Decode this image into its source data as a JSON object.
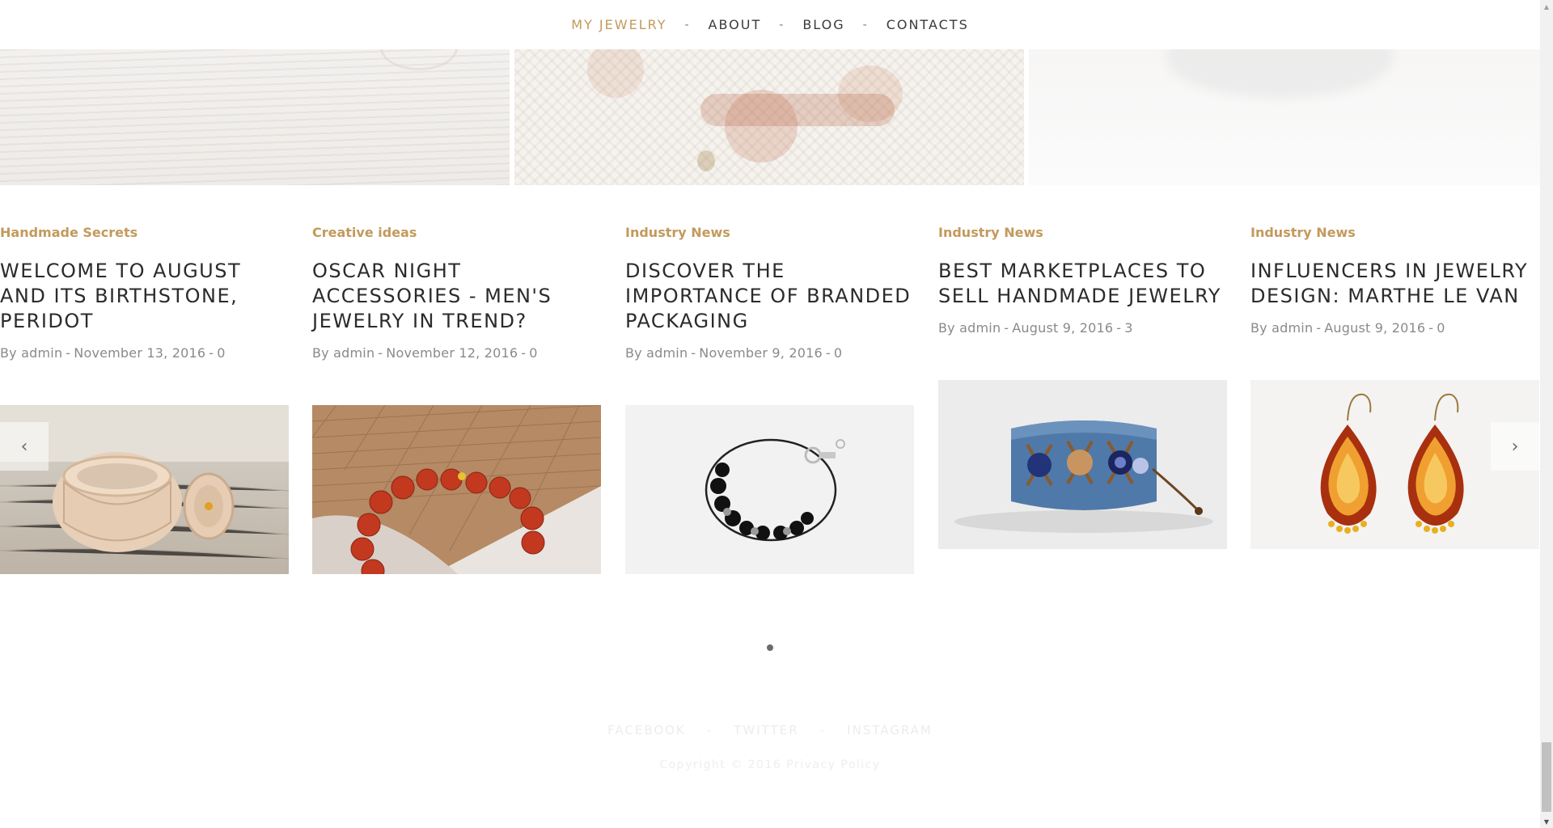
{
  "nav": {
    "items": [
      {
        "label": "MY JEWELRY",
        "active": true
      },
      {
        "label": "ABOUT",
        "active": false
      },
      {
        "label": "BLOG",
        "active": false
      },
      {
        "label": "CONTACTS",
        "active": false
      }
    ],
    "separator": "-"
  },
  "posts": [
    {
      "category": "Handmade Secrets",
      "title": "WELCOME TO AUGUST AND ITS BIRTHSTONE, PERIDOT",
      "author_prefix": "By",
      "author": "admin",
      "date": "November 13, 2016",
      "comments": "0",
      "image_icon": "bracelet-ring-photo-icon"
    },
    {
      "category": "Creative ideas",
      "title": "OSCAR NIGHT ACCESSORIES - MEN'S JEWELRY IN TREND?",
      "author_prefix": "By",
      "author": "admin",
      "date": "November 12, 2016",
      "comments": "0",
      "image_icon": "red-bead-bracelet-photo-icon"
    },
    {
      "category": "Industry News",
      "title": "DISCOVER THE IMPORTANCE OF BRANDED PACKAGING",
      "author_prefix": "By",
      "author": "admin",
      "date": "November 9, 2016",
      "comments": "0",
      "image_icon": "black-bead-bracelet-photo-icon"
    },
    {
      "category": "Industry News",
      "title": "BEST MARKETPLACES TO SELL HANDMADE JEWELRY",
      "author_prefix": "By",
      "author": "admin",
      "date": "August 9, 2016",
      "comments": "3",
      "image_icon": "blue-leather-cuff-photo-icon"
    },
    {
      "category": "Industry News",
      "title": "INFLUENCERS IN JEWELRY DESIGN: MARTHE LE VAN",
      "author_prefix": "By",
      "author": "admin",
      "date": "August 9, 2016",
      "comments": "0",
      "image_icon": "amber-earrings-photo-icon"
    }
  ],
  "carousel": {
    "prev_icon": "chevron-left-icon",
    "next_icon": "chevron-right-icon",
    "prev_glyph": "‹",
    "next_glyph": "›",
    "pages": 1,
    "active_page": 1
  },
  "footer": {
    "social": [
      "FACEBOOK",
      "TWITTER",
      "INSTAGRAM"
    ],
    "separator": "-",
    "copyright_text": "Copyright © 2016",
    "privacy_link": "Privacy Policy"
  },
  "colors": {
    "accent": "#c29a5c",
    "text": "#2b2b2b",
    "meta": "#8a8a8a"
  }
}
